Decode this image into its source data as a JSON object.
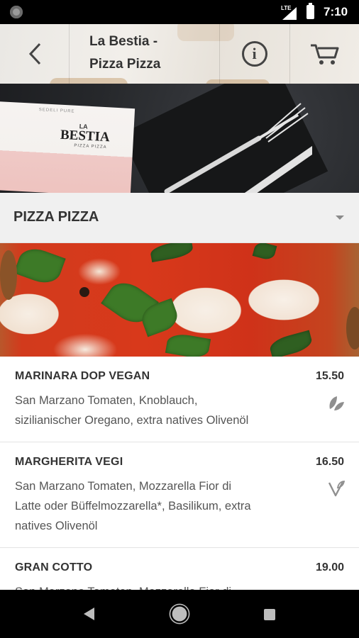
{
  "status_bar": {
    "network": "LTE",
    "time": "7:10"
  },
  "header": {
    "title_line1": "La Bestia -",
    "title_line2": "Pizza Pizza"
  },
  "hero": {
    "menu_card_small": "SEDELI PURE",
    "menu_card_la": "LA",
    "menu_card_brand": "BESTIA",
    "menu_card_sub": "PIZZA PIZZA"
  },
  "category": {
    "name": "PIZZA PIZZA"
  },
  "items": [
    {
      "name": "MARINARA DOP VEGAN",
      "price": "15.50",
      "desc_lines": [
        "San Marzano Tomaten, Knoblauch,",
        "sizilianischer Oregano, extra natives Olivenöl"
      ],
      "icon": "vegan-leaf-icon"
    },
    {
      "name": "MARGHERITA VEGI",
      "price": "16.50",
      "desc_lines": [
        "San Marzano Tomaten, Mozzarella Fior di",
        "Latte oder Büffelmozzarella*, Basilikum, extra",
        "natives Olivenöl"
      ],
      "icon": "vegetarian-v-icon"
    },
    {
      "name": "GRAN COTTO",
      "price": "19.00",
      "desc_lines": [
        "San Marzano Tomaten, Mozzarella Fior di"
      ]
    }
  ]
}
